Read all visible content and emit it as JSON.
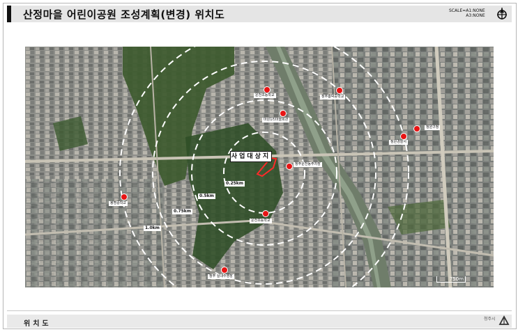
{
  "header": {
    "title": "산정마을 어린이공원 조성계획(변경) 위치도",
    "scale_line1": "SCALE=A1:NONE",
    "scale_line2": "A3:NONE"
  },
  "map": {
    "project_label": "사업대상지",
    "rings": [
      {
        "label": "0.25km"
      },
      {
        "label": "0.5km"
      },
      {
        "label": "0.75km"
      },
      {
        "label": "1.0km"
      }
    ],
    "landmarks": [
      {
        "label": "운천초등학교"
      },
      {
        "label": "마원1리마을회관"
      },
      {
        "label": "청주흥덕중학교"
      },
      {
        "label": "청원구청"
      },
      {
        "label": "청원경찰서"
      },
      {
        "label": "청주운천동주차장"
      },
      {
        "label": "봉명중학교"
      },
      {
        "label": "운천초등학교"
      },
      {
        "label": "청주 실내수영장"
      }
    ],
    "scale_text": "750m",
    "colors": {
      "marker": "#e81414",
      "ring": "#ffffff",
      "site_outline": "#ff2a2a"
    }
  },
  "footer": {
    "label": "위치도",
    "logo_text": "청주시"
  }
}
